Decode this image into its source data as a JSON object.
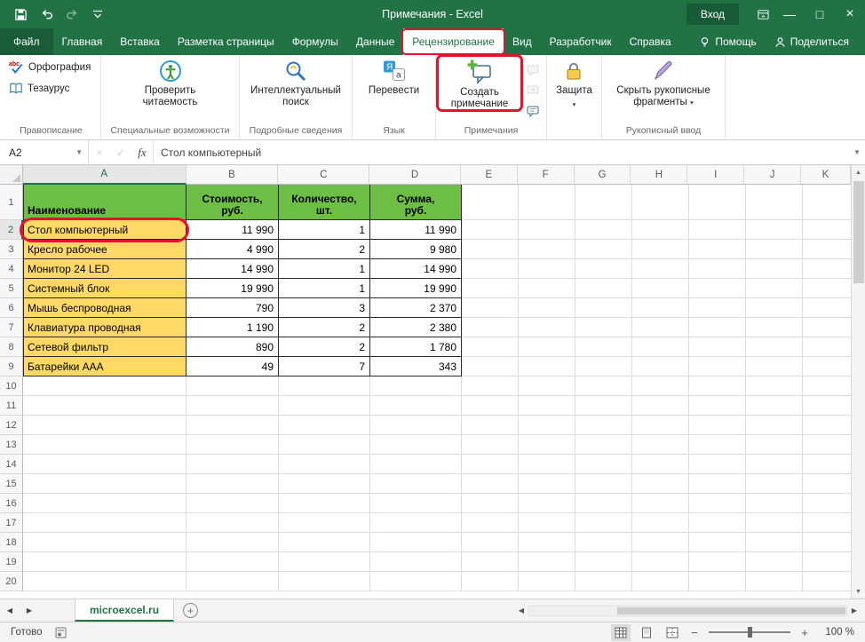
{
  "colors": {
    "excel_green": "#217346",
    "accent_red": "#E8112D",
    "table_header_green": "#6CBE45",
    "name_col_yellow": "#FFD966"
  },
  "titlebar": {
    "title": "Примечания - Excel",
    "login_label": "Вход"
  },
  "ribbon": {
    "selected_tab": "Рецензирование",
    "tabs": [
      {
        "label": "Файл"
      },
      {
        "label": "Главная"
      },
      {
        "label": "Вставка"
      },
      {
        "label": "Разметка страницы"
      },
      {
        "label": "Формулы"
      },
      {
        "label": "Данные"
      },
      {
        "label": "Рецензирование"
      },
      {
        "label": "Вид"
      },
      {
        "label": "Разработчик"
      },
      {
        "label": "Справка"
      },
      {
        "label": "Помощь"
      },
      {
        "label": "Поделиться"
      }
    ],
    "groups": [
      {
        "label": "Правописание",
        "buttons": [
          {
            "label": "Орфография"
          },
          {
            "label": "Тезаурус"
          }
        ]
      },
      {
        "label": "Специальные возможности",
        "buttons": [
          {
            "label": "Проверить читаемость"
          }
        ]
      },
      {
        "label": "Подробные сведения",
        "buttons": [
          {
            "label": "Интеллектуальный поиск"
          }
        ]
      },
      {
        "label": "Язык",
        "buttons": [
          {
            "label": "Перевести"
          }
        ]
      },
      {
        "label": "Примечания",
        "buttons": [
          {
            "label": "Создать примечание"
          }
        ]
      },
      {
        "label": "",
        "buttons": [
          {
            "label": "Защита"
          }
        ]
      },
      {
        "label": "Рукописный ввод",
        "buttons": [
          {
            "label": "Скрыть рукописные фрагменты"
          }
        ]
      }
    ]
  },
  "formula_bar": {
    "cell_ref": "A2",
    "fx_label": "fx",
    "formula": "Стол компьютерный"
  },
  "grid": {
    "columns": [
      "A",
      "B",
      "C",
      "D",
      "E",
      "F",
      "G",
      "H",
      "I",
      "J",
      "K"
    ],
    "row_count": 20,
    "selected_cell": "A2",
    "table": {
      "headers": [
        "Наименование",
        "Стоимость,\nруб.",
        "Количество,\nшт.",
        "Сумма,\nруб."
      ],
      "rows": [
        [
          "Стол компьютерный",
          "11 990",
          "1",
          "11 990"
        ],
        [
          "Кресло рабочее",
          "4 990",
          "2",
          "9 980"
        ],
        [
          "Монитор 24 LED",
          "14 990",
          "1",
          "14 990"
        ],
        [
          "Системный блок",
          "19 990",
          "1",
          "19 990"
        ],
        [
          "Мышь беспроводная",
          "790",
          "3",
          "2 370"
        ],
        [
          "Клавиатура проводная",
          "1 190",
          "2",
          "2 380"
        ],
        [
          "Сетевой фильтр",
          "890",
          "2",
          "1 780"
        ],
        [
          "Батарейки AAA",
          "49",
          "7",
          "343"
        ]
      ]
    }
  },
  "sheet_bar": {
    "active_tab": "microexcel.ru"
  },
  "status_bar": {
    "mode": "Готово",
    "zoom": "100 %"
  }
}
